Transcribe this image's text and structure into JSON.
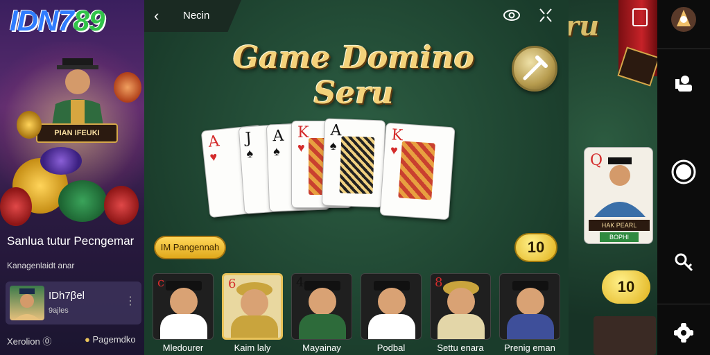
{
  "left_panel": {
    "logo_part1": "IDN7",
    "logo_part2": "89",
    "promo_sign": "PIAN IFEUKI",
    "title": "Sanlua tutur Pecngemar",
    "subtitle": "Kanagenlaidt anar",
    "profile": {
      "name": "IDh7βel",
      "sub": "9ajles"
    },
    "footer_left": "Xerolion",
    "footer_right": "Pagemdko"
  },
  "center_panel": {
    "top_title": "Necin",
    "game_title": "Game Domino Seru",
    "pill_label": "IM Pangennah",
    "score": "10",
    "cards": [
      {
        "rank": "A",
        "suit": "♥",
        "color": "red"
      },
      {
        "rank": "J",
        "suit": "♠",
        "color": "blk"
      },
      {
        "rank": "A",
        "suit": "♠",
        "color": "blk"
      },
      {
        "rank": "K",
        "suit": "♥",
        "color": "red"
      },
      {
        "rank": "A",
        "suit": "♠",
        "color": "blk"
      },
      {
        "rank": "K",
        "suit": "♥",
        "color": "red"
      }
    ],
    "players": [
      {
        "name": "Mledourer",
        "rank": "c",
        "body": "#ffffff",
        "rank_color": "red"
      },
      {
        "name": "Kaim laly",
        "rank": "6",
        "body": "#c9a43d",
        "rank_color": "red"
      },
      {
        "name": "Mayainay",
        "rank": "4",
        "body": "#2d6b3a",
        "rank_color": "blk"
      },
      {
        "name": "Podbal",
        "rank": "",
        "body": "#ffffff",
        "rank_color": "blk"
      },
      {
        "name": "Settu enara",
        "rank": "8",
        "body": "#e3d6a8",
        "rank_color": "red"
      },
      {
        "name": "Prenig eman",
        "rank": "",
        "body": "#3e4f9a",
        "rank_color": "blk"
      }
    ]
  },
  "right_bg": {
    "title_fragment": "ru",
    "card_sign": "HAK PEARL",
    "card_sign2": "BOPHI",
    "score": "10"
  },
  "navbar": {
    "icons": [
      "app-logo-icon",
      "profile-icon",
      "record-icon",
      "key-search-icon",
      "settings-icon"
    ]
  },
  "colors": {
    "accent_gold": "#e9c35a",
    "table_green": "#1f4a34"
  }
}
